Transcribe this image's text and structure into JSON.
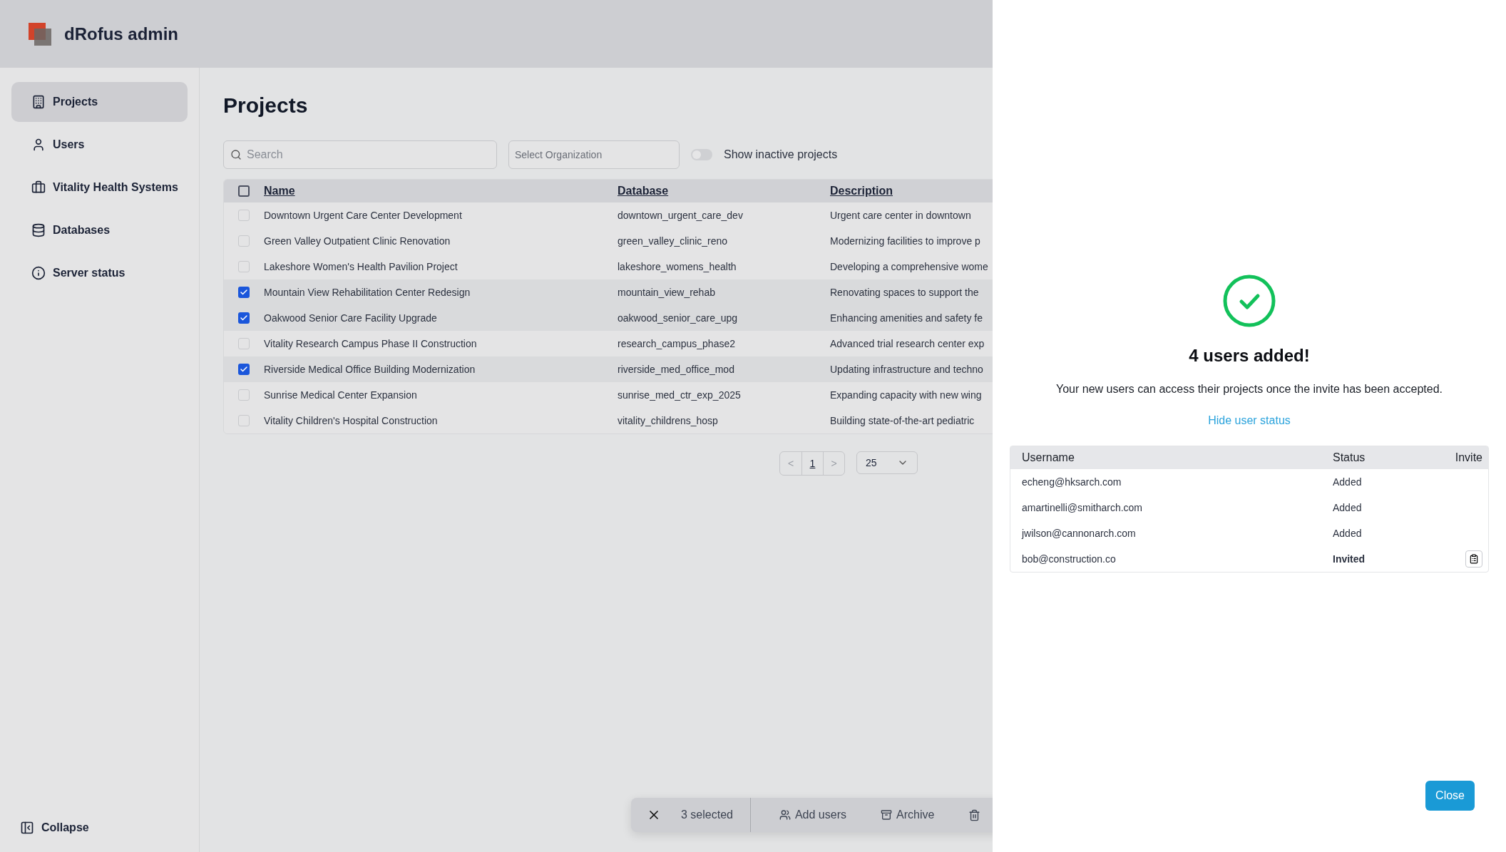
{
  "app": {
    "title": "dRofus admin"
  },
  "sidebar": {
    "items": [
      {
        "label": "Projects",
        "selected": true
      },
      {
        "label": "Users",
        "selected": false
      },
      {
        "label": "Vitality Health Systems",
        "selected": false
      },
      {
        "label": "Databases",
        "selected": false
      },
      {
        "label": "Server status",
        "selected": false
      }
    ],
    "collapse": "Collapse"
  },
  "page": {
    "title": "Projects"
  },
  "filters": {
    "search": {
      "placeholder": "Search"
    },
    "organization": {
      "placeholder": "Select Organization"
    },
    "inactive_toggle": {
      "label": "Show inactive projects",
      "on": false
    }
  },
  "table": {
    "header_checked": false,
    "columns": [
      "Name",
      "Database",
      "Description"
    ],
    "rows": [
      {
        "name": "Downtown Urgent Care Center Development",
        "database": "downtown_urgent_care_dev",
        "description": "Urgent care center in downtown",
        "checked": false
      },
      {
        "name": "Green Valley Outpatient Clinic Renovation",
        "database": "green_valley_clinic_reno",
        "description": "Modernizing facilities to improve p",
        "checked": false
      },
      {
        "name": "Lakeshore Women's Health Pavilion Project",
        "database": "lakeshore_womens_health",
        "description": "Developing a comprehensive wome",
        "checked": false
      },
      {
        "name": "Mountain View Rehabilitation Center Redesign",
        "database": "mountain_view_rehab",
        "description": "Renovating spaces to support the",
        "checked": true
      },
      {
        "name": "Oakwood Senior Care Facility Upgrade",
        "database": "oakwood_senior_care_upg",
        "description": "Enhancing amenities and safety fe",
        "checked": true
      },
      {
        "name": "Vitality Research Campus Phase II Construction",
        "database": "research_campus_phase2",
        "description": "Advanced trial research center exp",
        "checked": false
      },
      {
        "name": "Riverside Medical Office Building Modernization",
        "database": "riverside_med_office_mod",
        "description": "Updating infrastructure and techno",
        "checked": true
      },
      {
        "name": "Sunrise Medical Center Expansion",
        "database": "sunrise_med_ctr_exp_2025",
        "description": "Expanding capacity with new wing",
        "checked": false
      },
      {
        "name": "Vitality Children's Hospital Construction",
        "database": "vitality_childrens_hosp",
        "description": "Building state-of-the-art pediatric",
        "checked": false
      }
    ]
  },
  "pagination": {
    "prev": "<",
    "page": "1",
    "next": ">",
    "per_page": "25"
  },
  "bulk_bar": {
    "count": "3 selected",
    "actions": [
      "Add users",
      "Archive"
    ]
  },
  "panel": {
    "heading": "4 users added!",
    "message": "Your new users can access their projects once the invite has been accepted.",
    "link": "Hide user status",
    "table": {
      "columns": [
        "Username",
        "Status",
        "Invite"
      ],
      "rows": [
        {
          "username": "echeng@hksarch.com",
          "status": "Added",
          "kind": "added"
        },
        {
          "username": "amartinelli@smitharch.com",
          "status": "Added",
          "kind": "added"
        },
        {
          "username": "jwilson@cannonarch.com",
          "status": "Added",
          "kind": "added"
        },
        {
          "username": "bob@construction.co",
          "status": "Invited",
          "kind": "invited"
        }
      ]
    },
    "close": "Close"
  }
}
